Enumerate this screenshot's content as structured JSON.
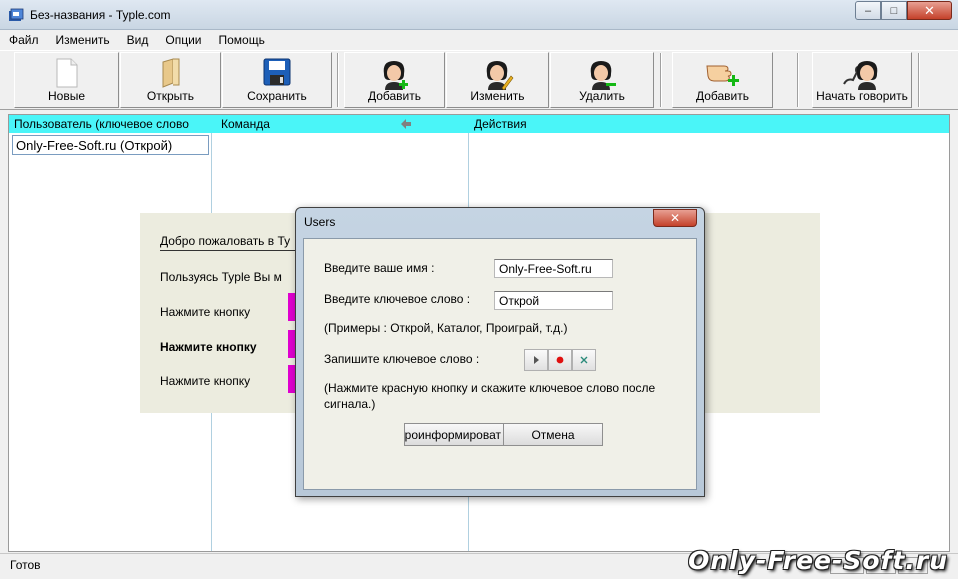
{
  "window": {
    "title": "Без-названия - Typle.com",
    "controls": {
      "minimize": "‒",
      "maximize": "□",
      "close": "✕"
    }
  },
  "menu": [
    {
      "label": "Файл"
    },
    {
      "label": "Изменить"
    },
    {
      "label": "Вид"
    },
    {
      "label": "Опции"
    },
    {
      "label": "Помощь"
    }
  ],
  "toolbar": {
    "new_label": "Новые",
    "open_label": "Открыть",
    "save_label": "Сохранить",
    "add_user_label": "Добавить",
    "edit_user_label": "Изменить",
    "delete_user_label": "Удалить",
    "add_command_label": "Добавить",
    "start_talk_label": "Начать говорить"
  },
  "table": {
    "headers": [
      "Пользователь (ключевое слово",
      "Команда",
      "Действия"
    ],
    "rows": [
      {
        "user": "Only-Free-Soft.ru (Открой)"
      }
    ]
  },
  "welcome": {
    "title": "Добро пожаловать в Ty",
    "line1": "Пользуясь Typle Вы м",
    "line2": "Нажмите кнопку",
    "line3": "Нажмите кнопку",
    "line4": "Нажмите кнопку"
  },
  "dialog": {
    "title": "Users",
    "close": "✕",
    "name_label": "Введите ваше имя :",
    "name_value": "Only-Free-Soft.ru",
    "keyword_label": "Введите ключевое слово :",
    "keyword_value": "Открой",
    "examples": "(Примеры : Открой, Каталог, Проиграй, т.д.)",
    "record_label": "Запишите ключевое слово :",
    "record_hint": "(Нажмите красную кнопку и скажите ключевое слово после сигнала.)",
    "ok_label": "роинформироват",
    "cancel_label": "Отмена"
  },
  "status": {
    "text": "Готов",
    "watermark": "Only-Free-Soft.ru"
  },
  "colors": {
    "header_bg": "#4af5f8",
    "welcome_bg": "#ececdf",
    "record_red": "#e01010"
  }
}
